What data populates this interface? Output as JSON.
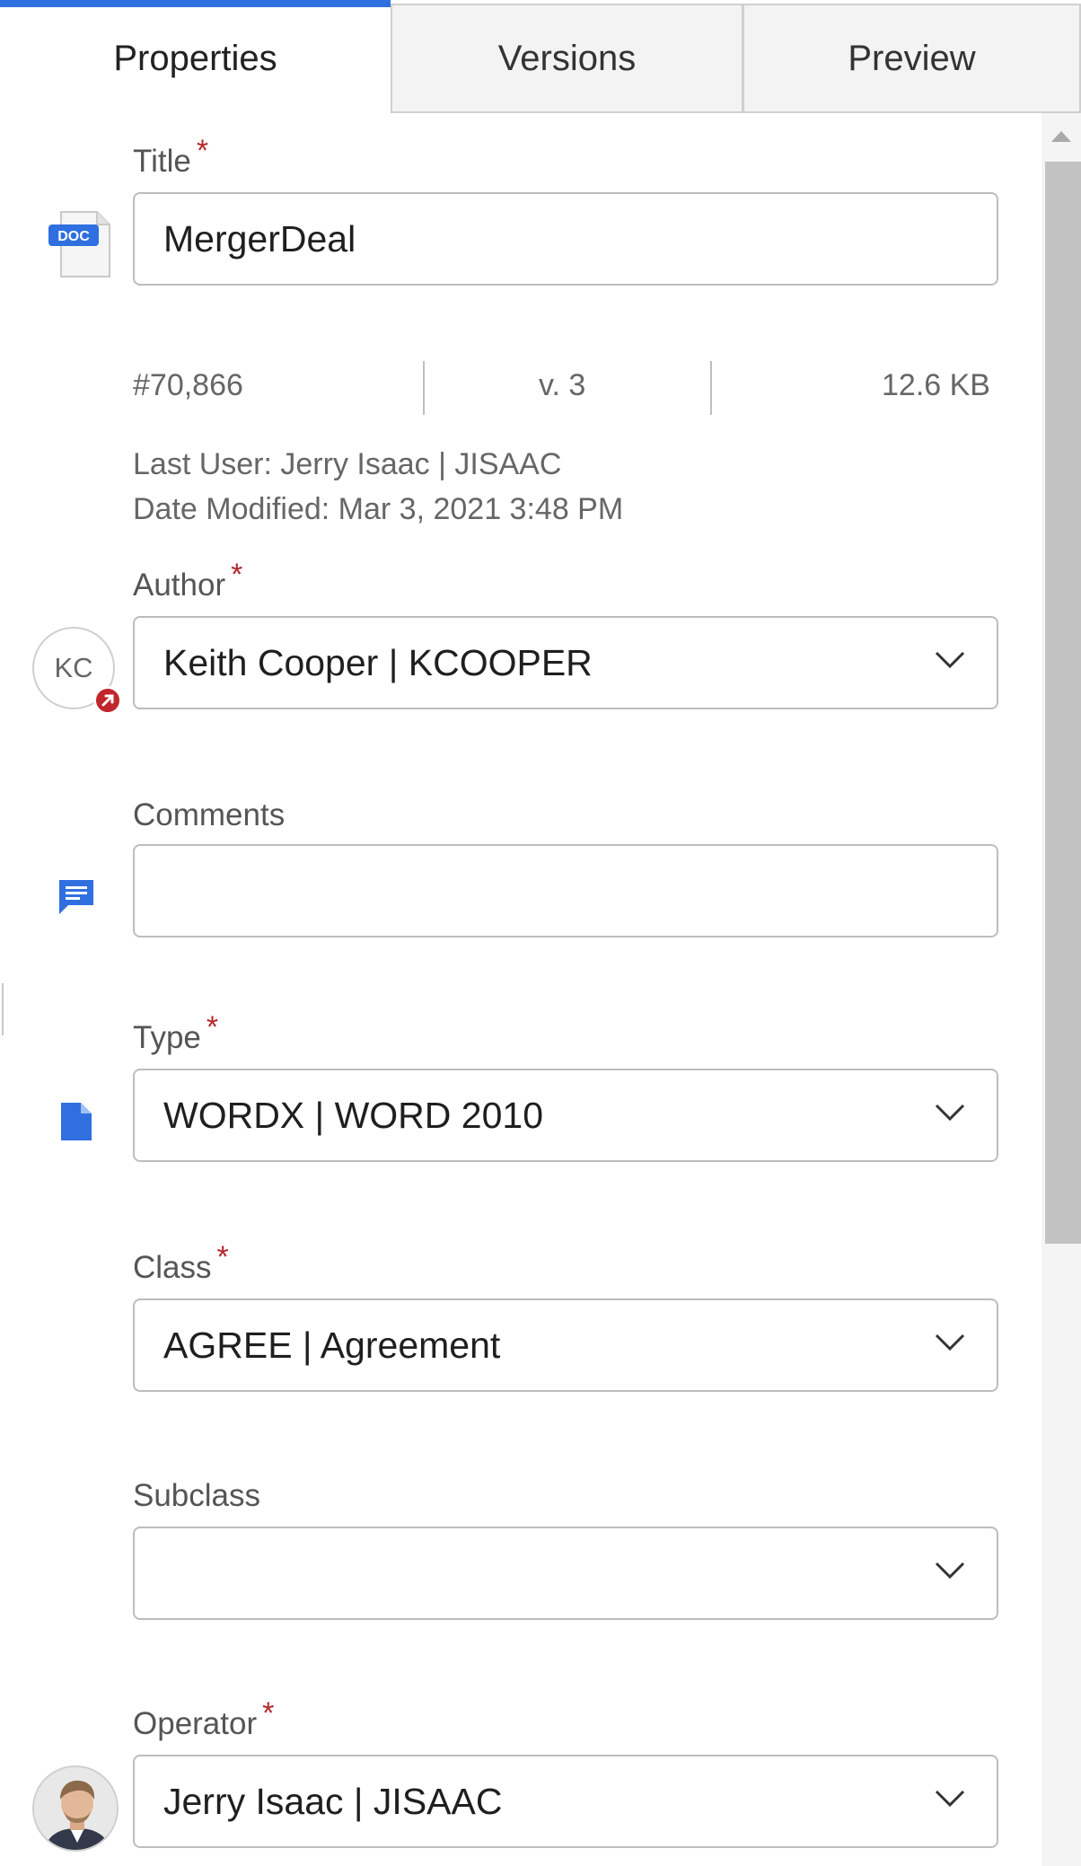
{
  "tabs": [
    {
      "label": "Properties",
      "active": true
    },
    {
      "label": "Versions",
      "active": false
    },
    {
      "label": "Preview",
      "active": false
    }
  ],
  "accent_color": "#2f6fe0",
  "required_color": "#b5262b",
  "document": {
    "icon": "doc-file-icon",
    "icon_badge": "DOC",
    "title_label": "Title",
    "title_value": "MergerDeal",
    "number": "#70,866",
    "version": "v. 3",
    "size": "12.6 KB",
    "last_user": "Last User: Jerry Isaac | JISAAC",
    "date_modified": "Date Modified: Mar 3, 2021 3:48 PM"
  },
  "fields": {
    "author": {
      "label": "Author",
      "value": "Keith Cooper | KCOOPER",
      "avatar_initials": "KC",
      "required": true
    },
    "comments": {
      "label": "Comments",
      "value": "",
      "required": false
    },
    "type": {
      "label": "Type",
      "value": "WORDX | WORD 2010",
      "required": true
    },
    "class": {
      "label": "Class",
      "value": "AGREE | Agreement",
      "required": true
    },
    "subclass": {
      "label": "Subclass",
      "value": "",
      "required": false
    },
    "operator": {
      "label": "Operator",
      "value": "Jerry Isaac | JISAAC",
      "required": true
    }
  },
  "required_mark": "*"
}
